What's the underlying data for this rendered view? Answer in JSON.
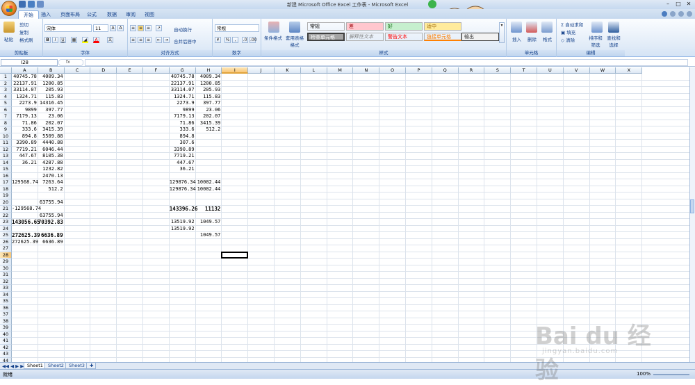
{
  "window": {
    "title": "新建 Microsoft Office Excel 工作表 - Microsoft Excel"
  },
  "tabs": [
    "开始",
    "插入",
    "页面布局",
    "公式",
    "数据",
    "审阅",
    "视图"
  ],
  "ribbon": {
    "clipboard": {
      "label": "剪贴板",
      "paste": "粘贴",
      "cut": "剪切",
      "copy": "复制",
      "format_painter": "格式刷"
    },
    "font": {
      "label": "字体",
      "name": "宋体",
      "size": "11"
    },
    "alignment": {
      "label": "对齐方式",
      "wrap": "自动换行",
      "merge": "合并后居中"
    },
    "number": {
      "label": "数字",
      "format": "常规"
    },
    "styles": {
      "label": "样式",
      "conditional": "条件格式",
      "table": "套用表格格式",
      "cells": [
        {
          "text": "常规",
          "bg": "#ffffff",
          "color": "#000000"
        },
        {
          "text": "差",
          "bg": "#ffc7ce",
          "color": "#9c0006"
        },
        {
          "text": "好",
          "bg": "#c6efce",
          "color": "#006100"
        },
        {
          "text": "适中",
          "bg": "#ffeb9c",
          "color": "#9c6500"
        },
        {
          "text": "检查单元格",
          "bg": "#a5a5a5",
          "color": "#ffffff"
        },
        {
          "text": "解释性文本",
          "bg": "#ffffff",
          "color": "#7f7f7f"
        },
        {
          "text": "警告文本",
          "bg": "#ffffff",
          "color": "#ff0000"
        },
        {
          "text": "链接单元格",
          "bg": "#ffffff",
          "color": "#fa7d00"
        },
        {
          "text": "输出",
          "bg": "#f2f2f2",
          "color": "#3f3f3f"
        }
      ]
    },
    "cells_group": {
      "label": "单元格",
      "insert": "插入",
      "delete": "删除",
      "format": "格式"
    },
    "editing": {
      "label": "编辑",
      "autosum": "自动求和",
      "fill": "填充",
      "clear": "清除",
      "sort": "排序和筛选",
      "find": "查找和选择"
    }
  },
  "formula_bar": {
    "name_box": "I28",
    "fx": "fx",
    "content": ""
  },
  "columns": [
    "A",
    "B",
    "C",
    "D",
    "E",
    "F",
    "G",
    "H",
    "I",
    "J",
    "K",
    "L",
    "M",
    "N",
    "O",
    "P",
    "Q",
    "R",
    "S",
    "T",
    "U",
    "V",
    "W",
    "X"
  ],
  "selected": {
    "column": "I",
    "row": 28
  },
  "rows": 44,
  "cells": [
    {
      "col": "A",
      "row": 1,
      "v": "40745.78"
    },
    {
      "col": "B",
      "row": 1,
      "v": "4009.34"
    },
    {
      "col": "A",
      "row": 2,
      "v": "22137.91"
    },
    {
      "col": "B",
      "row": 2,
      "v": "1200.85"
    },
    {
      "col": "A",
      "row": 3,
      "v": "33114.07"
    },
    {
      "col": "B",
      "row": 3,
      "v": "205.93"
    },
    {
      "col": "A",
      "row": 4,
      "v": "1324.71"
    },
    {
      "col": "B",
      "row": 4,
      "v": "115.83"
    },
    {
      "col": "A",
      "row": 5,
      "v": "2273.9"
    },
    {
      "col": "B",
      "row": 5,
      "v": "14316.45"
    },
    {
      "col": "A",
      "row": 6,
      "v": "9899"
    },
    {
      "col": "B",
      "row": 6,
      "v": "397.77"
    },
    {
      "col": "A",
      "row": 7,
      "v": "7179.13"
    },
    {
      "col": "B",
      "row": 7,
      "v": "23.06"
    },
    {
      "col": "A",
      "row": 8,
      "v": "71.86"
    },
    {
      "col": "B",
      "row": 8,
      "v": "202.07"
    },
    {
      "col": "A",
      "row": 9,
      "v": "333.6"
    },
    {
      "col": "B",
      "row": 9,
      "v": "3415.39"
    },
    {
      "col": "A",
      "row": 10,
      "v": "894.8"
    },
    {
      "col": "B",
      "row": 10,
      "v": "5509.88"
    },
    {
      "col": "A",
      "row": 11,
      "v": "3390.89"
    },
    {
      "col": "B",
      "row": 11,
      "v": "4440.88"
    },
    {
      "col": "A",
      "row": 12,
      "v": "7719.21"
    },
    {
      "col": "B",
      "row": 12,
      "v": "6046.44"
    },
    {
      "col": "A",
      "row": 13,
      "v": "447.67"
    },
    {
      "col": "B",
      "row": 13,
      "v": "8105.38"
    },
    {
      "col": "A",
      "row": 14,
      "v": "36.21"
    },
    {
      "col": "B",
      "row": 14,
      "v": "4287.88"
    },
    {
      "col": "B",
      "row": 15,
      "v": "1232.82"
    },
    {
      "col": "B",
      "row": 16,
      "v": "2470.13"
    },
    {
      "col": "A",
      "row": 17,
      "v": "129568.74"
    },
    {
      "col": "B",
      "row": 17,
      "v": "7263.64"
    },
    {
      "col": "B",
      "row": 18,
      "v": "512.2"
    },
    {
      "col": "B",
      "row": 20,
      "v": "63755.94"
    },
    {
      "col": "A",
      "row": 21,
      "v": "-129568.74"
    },
    {
      "col": "B",
      "row": 22,
      "v": "63755.94"
    },
    {
      "col": "A",
      "row": 23,
      "v": "143056.65",
      "b": true
    },
    {
      "col": "B",
      "row": 23,
      "v": "70392.83",
      "b": true
    },
    {
      "col": "A",
      "row": 25,
      "v": "272625.39",
      "b": true
    },
    {
      "col": "B",
      "row": 25,
      "v": "6636.89",
      "b": true
    },
    {
      "col": "A",
      "row": 26,
      "v": "272625.39"
    },
    {
      "col": "B",
      "row": 26,
      "v": "6636.89"
    },
    {
      "col": "G",
      "row": 1,
      "v": "40745.78"
    },
    {
      "col": "H",
      "row": 1,
      "v": "4009.34"
    },
    {
      "col": "G",
      "row": 2,
      "v": "22137.91"
    },
    {
      "col": "H",
      "row": 2,
      "v": "1200.85"
    },
    {
      "col": "G",
      "row": 3,
      "v": "33114.07"
    },
    {
      "col": "H",
      "row": 3,
      "v": "205.93"
    },
    {
      "col": "G",
      "row": 4,
      "v": "1324.71"
    },
    {
      "col": "H",
      "row": 4,
      "v": "115.83"
    },
    {
      "col": "G",
      "row": 5,
      "v": "2273.9"
    },
    {
      "col": "H",
      "row": 5,
      "v": "397.77"
    },
    {
      "col": "G",
      "row": 6,
      "v": "9899"
    },
    {
      "col": "H",
      "row": 6,
      "v": "23.06"
    },
    {
      "col": "G",
      "row": 7,
      "v": "7179.13"
    },
    {
      "col": "H",
      "row": 7,
      "v": "202.07"
    },
    {
      "col": "G",
      "row": 8,
      "v": "71.86"
    },
    {
      "col": "H",
      "row": 8,
      "v": "3415.39"
    },
    {
      "col": "G",
      "row": 9,
      "v": "333.6"
    },
    {
      "col": "H",
      "row": 9,
      "v": "512.2"
    },
    {
      "col": "G",
      "row": 10,
      "v": "894.8"
    },
    {
      "col": "G",
      "row": 11,
      "v": "307.6"
    },
    {
      "col": "G",
      "row": 12,
      "v": "3390.89"
    },
    {
      "col": "G",
      "row": 13,
      "v": "7719.21"
    },
    {
      "col": "G",
      "row": 14,
      "v": "447.67"
    },
    {
      "col": "G",
      "row": 15,
      "v": "36.21"
    },
    {
      "col": "G",
      "row": 17,
      "v": "129876.34"
    },
    {
      "col": "H",
      "row": 17,
      "v": "10082.44"
    },
    {
      "col": "G",
      "row": 18,
      "v": "129876.34"
    },
    {
      "col": "H",
      "row": 18,
      "v": "10082.44"
    },
    {
      "col": "G",
      "row": 21,
      "v": "143396.26",
      "b": true
    },
    {
      "col": "H",
      "row": 21,
      "v": "11132",
      "b": true
    },
    {
      "col": "G",
      "row": 23,
      "v": "13519.92"
    },
    {
      "col": "H",
      "row": 23,
      "v": "1049.57"
    },
    {
      "col": "G",
      "row": 24,
      "v": "13519.92"
    },
    {
      "col": "H",
      "row": 25,
      "v": "1049.57"
    }
  ],
  "sheets": [
    "Sheet1",
    "Sheet2",
    "Sheet3"
  ],
  "status": {
    "ready": "就绪",
    "zoom": "100%"
  },
  "watermark": {
    "main": "Bai du 经验",
    "sub": "jingyan.baidu.com"
  }
}
